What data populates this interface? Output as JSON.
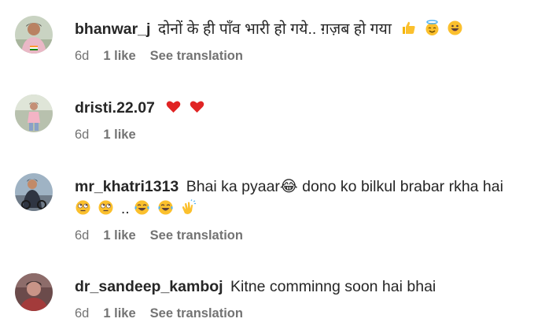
{
  "comments": [
    {
      "username": "bhanwar_j",
      "text": "दोनों के ही पाँव भारी हो गये.. ग़ज़ब हो गया",
      "emojis": [
        "thumbs-up-icon",
        "halo-face-icon",
        "grinning-face-icon"
      ],
      "time": "6d",
      "likes": "1 like",
      "translate": "See translation",
      "avatar_colors": [
        "#c9d0c6",
        "#e9b9c4",
        "#1f7c2a"
      ]
    },
    {
      "username": "dristi.22.07",
      "text": "",
      "emojis": [
        "red-heart-icon",
        "red-heart-icon"
      ],
      "time": "6d",
      "likes": "1 like",
      "translate": "",
      "avatar_colors": [
        "#a9b4a3",
        "#f1b8c6",
        "#5f5648"
      ]
    },
    {
      "username": "mr_khatri1313",
      "text": "Bhai ka pyaar😂  dono ko bilkul brabar rkha hai",
      "emojis": [
        "eye-roll-icon",
        "eye-roll-icon"
      ],
      "text_continued": "..",
      "emojis_after": [
        "tears-of-joy-icon",
        "tears-of-joy-icon",
        "clapping-hands-icon"
      ],
      "time": "6d",
      "likes": "1 like",
      "translate": "See translation",
      "avatar_colors": [
        "#8fa6b9",
        "#2d3340",
        "#5a6475"
      ]
    },
    {
      "username": "dr_sandeep_kamboj",
      "text": "Kitne comminng soon hai bhai",
      "time": "6d",
      "likes": "1 like",
      "translate": "See translation",
      "avatar_colors": [
        "#6a4a4a",
        "#c28c8a",
        "#3a2b2b"
      ]
    }
  ]
}
